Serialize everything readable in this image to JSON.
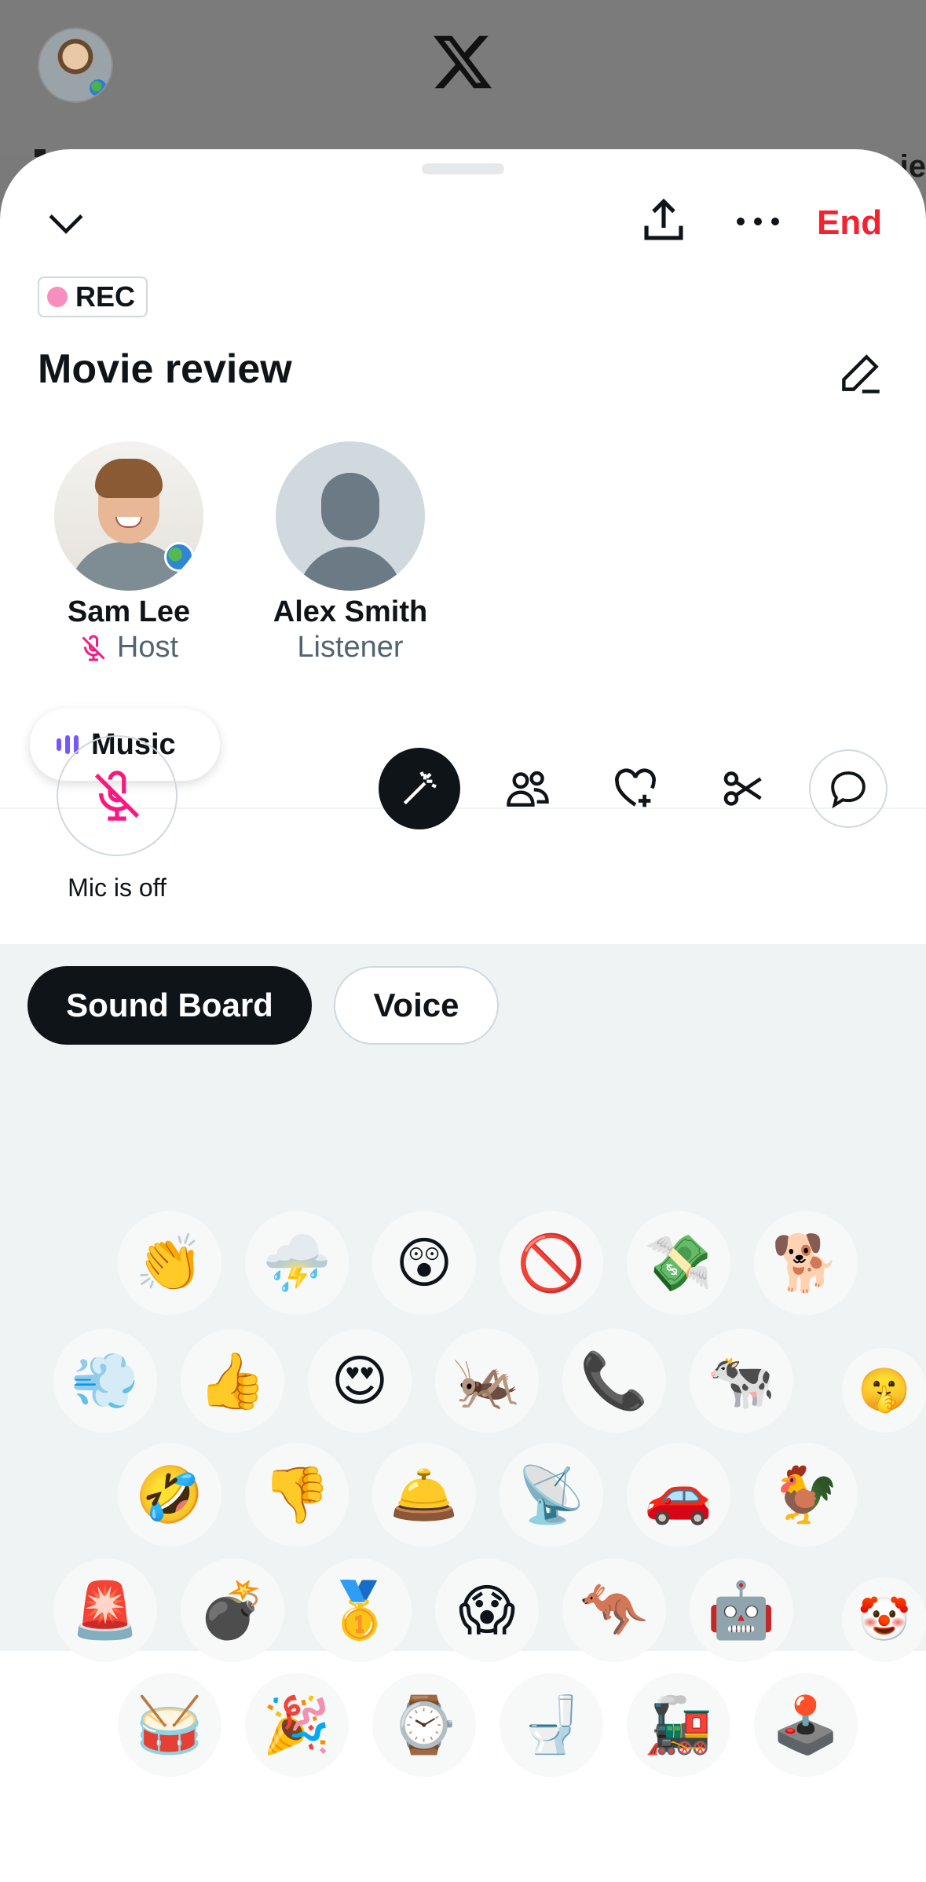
{
  "space": {
    "rec_label": "REC",
    "title": "Movie review",
    "end_label": "End"
  },
  "speakers": [
    {
      "name": "Sam Lee",
      "role": "Host"
    },
    {
      "name": "Alex Smith",
      "role": "Listener"
    }
  ],
  "music_label": "Music",
  "mic_label": "Mic is off",
  "tabs": [
    "Sound Board",
    "Voice"
  ],
  "sounds": [
    [
      "👏",
      "⛈️",
      "😲",
      "🚫",
      "💸",
      "🐕"
    ],
    [
      "💨",
      "👍",
      "😍",
      "🦗",
      "📞",
      "🐄",
      "🤫"
    ],
    [
      "🤣",
      "👎",
      "🛎️",
      "📡",
      "🚗",
      "🐓"
    ],
    [
      "🚨",
      "💣",
      "🥇",
      "😱",
      "🦘",
      "🤖",
      "🤡"
    ],
    [
      "🥁",
      "🎉",
      "⌚",
      "🚽",
      "🚂",
      "🕹️"
    ]
  ],
  "colors": {
    "end": "#f4212e",
    "rec_dot": "#f78fbe",
    "mic_off": "#f91880",
    "music_bars": "#7856ff"
  }
}
